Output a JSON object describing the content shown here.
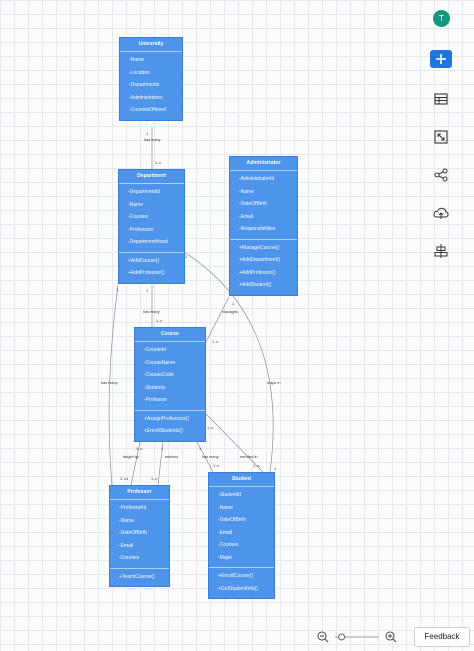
{
  "user": {
    "avatar_letter": "T"
  },
  "toolbar": {
    "add_icon": "plus-icon",
    "tools": [
      "table-icon",
      "fit-screen-icon",
      "share-icon",
      "cloud-upload-icon",
      "align-center-icon"
    ]
  },
  "zoom": {
    "out_icon": "zoom-out-icon",
    "in_icon": "zoom-in-icon",
    "slider_value": 0.15
  },
  "feedback_label": "Feedback",
  "colors": {
    "class_fill": "#4d94ea",
    "accent": "#1f75e0",
    "avatar": "#14977e"
  },
  "classes": [
    {
      "id": "university",
      "name": "University",
      "attributes": [
        "-Name",
        "-Location",
        "-Departments",
        "-Administrators",
        "-CoursesOffered"
      ],
      "methods": []
    },
    {
      "id": "department",
      "name": "Department",
      "attributes": [
        "-DepartmentId",
        "-Name",
        "-Courses",
        "-Professors",
        "-DepartmentHead"
      ],
      "methods": [
        "+AddCourse()",
        "+AddProfessor()"
      ]
    },
    {
      "id": "administrator",
      "name": "Administrator",
      "attributes": [
        "-AdministratorId",
        "-Name",
        "-DateOfBirth",
        "-Email",
        "-Responsibilities"
      ],
      "methods": [
        "+ManageCourse()",
        "+AddDepartment()",
        "+AddProfessor()",
        "+AddStudent()"
      ]
    },
    {
      "id": "course",
      "name": "Course",
      "attributes": [
        "-CourseId",
        "-CourseName",
        "-CourseCode",
        "-Students",
        "-Professor"
      ],
      "methods": [
        "+AssignProfessors()",
        "+EnrollStudents()"
      ]
    },
    {
      "id": "professor",
      "name": "Professor",
      "attributes": [
        "-ProfessorId",
        "-Name",
        "-DateOfBirth",
        "-Email",
        "-Courses"
      ],
      "methods": [
        "+TeachCourse()"
      ]
    },
    {
      "id": "student",
      "name": "Student",
      "attributes": [
        "-StudentId",
        "-Name",
        "-DateOfBirth",
        "-Email",
        "-Courses",
        "-Major"
      ],
      "methods": [
        "+EnrollCourse()",
        "+GetStudentInfo()"
      ]
    }
  ],
  "relations": [
    {
      "from": "university",
      "to": "department",
      "label": "has many",
      "from_mult": "1",
      "to_mult": "1..n"
    },
    {
      "from": "department",
      "to": "course",
      "label": "has many",
      "from_mult": "1",
      "to_mult": "1..n"
    },
    {
      "from": "department",
      "to": "professor",
      "label": "has many",
      "from_mult": "1",
      "to_mult": "1..n"
    },
    {
      "from": "administrator",
      "to": "course",
      "label": "manages",
      "from_mult": "1",
      "to_mult": "1..n"
    },
    {
      "from": "department",
      "to": "student",
      "label": "major in",
      "from_mult": "1",
      "to_mult": "1"
    },
    {
      "from": "course",
      "to": "professor",
      "label": "taught by",
      "from_mult": "1..n",
      "to_mult": "1"
    },
    {
      "from": "professor",
      "to": "course",
      "label": "teaches",
      "from_mult": "1",
      "to_mult": "1..n"
    },
    {
      "from": "course",
      "to": "student",
      "label": "has many",
      "from_mult": "1",
      "to_mult": "1..n"
    },
    {
      "from": "student",
      "to": "course",
      "label": "enrolled in",
      "from_mult": "1..n",
      "to_mult": "1..n"
    }
  ]
}
